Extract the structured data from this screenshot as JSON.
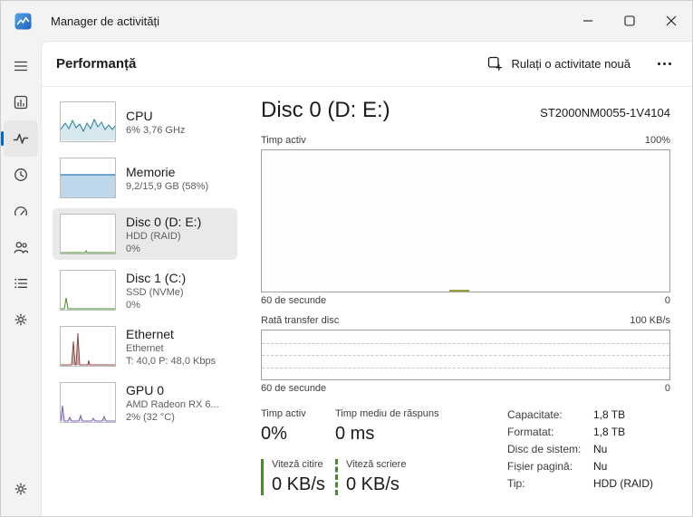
{
  "theme": {
    "accent": "#0067c0",
    "cpu_color": "#1d7f9e",
    "memory_color": "#2a7ab8",
    "disk_color": "#4a8c2a",
    "ethernet_color": "#8e4a43",
    "gpu_color": "#7b5fb5"
  },
  "titlebar": {
    "title": "Manager de activități"
  },
  "header": {
    "title": "Performanță",
    "run_task": "Rulați o activitate nouă"
  },
  "perf": {
    "items": [
      {
        "name": "CPU",
        "line1": "6% 3,76 GHz",
        "line2": ""
      },
      {
        "name": "Memorie",
        "line1": "9,2/15,9 GB (58%)",
        "line2": ""
      },
      {
        "name": "Disc 0 (D: E:)",
        "line1": "HDD (RAID)",
        "line2": "0%"
      },
      {
        "name": "Disc 1 (C:)",
        "line1": "SSD (NVMe)",
        "line2": "0%"
      },
      {
        "name": "Ethernet",
        "line1": "Ethernet",
        "line2": "T: 40,0 P: 48,0 Kbps"
      },
      {
        "name": "GPU 0",
        "line1": "AMD Radeon RX 6...",
        "line2": "2% (32 °C)"
      }
    ]
  },
  "main": {
    "title": "Disc 0 (D: E:)",
    "device": "ST2000NM0055-1V4104",
    "active_chart": {
      "label": "Timp activ",
      "max": "100%",
      "x_left": "60 de secunde",
      "x_right": "0"
    },
    "transfer_chart": {
      "label": "Rată transfer disc",
      "max": "100 KB/s",
      "x_left": "60 de secunde",
      "x_right": "0"
    },
    "stats": [
      {
        "label": "Timp activ",
        "value": "0%"
      },
      {
        "label": "Timp mediu de răspuns",
        "value": "0 ms"
      },
      {
        "label": "Viteză citire",
        "value": "0 KB/s"
      },
      {
        "label": "Viteză scriere",
        "value": "0 KB/s"
      }
    ],
    "details": [
      {
        "label": "Capacitate:",
        "value": "1,8 TB"
      },
      {
        "label": "Formatat:",
        "value": "1,8 TB"
      },
      {
        "label": "Disc de sistem:",
        "value": "Nu"
      },
      {
        "label": "Fișier pagină:",
        "value": "Nu"
      },
      {
        "label": "Tip:",
        "value": "HDD (RAID)"
      }
    ]
  }
}
